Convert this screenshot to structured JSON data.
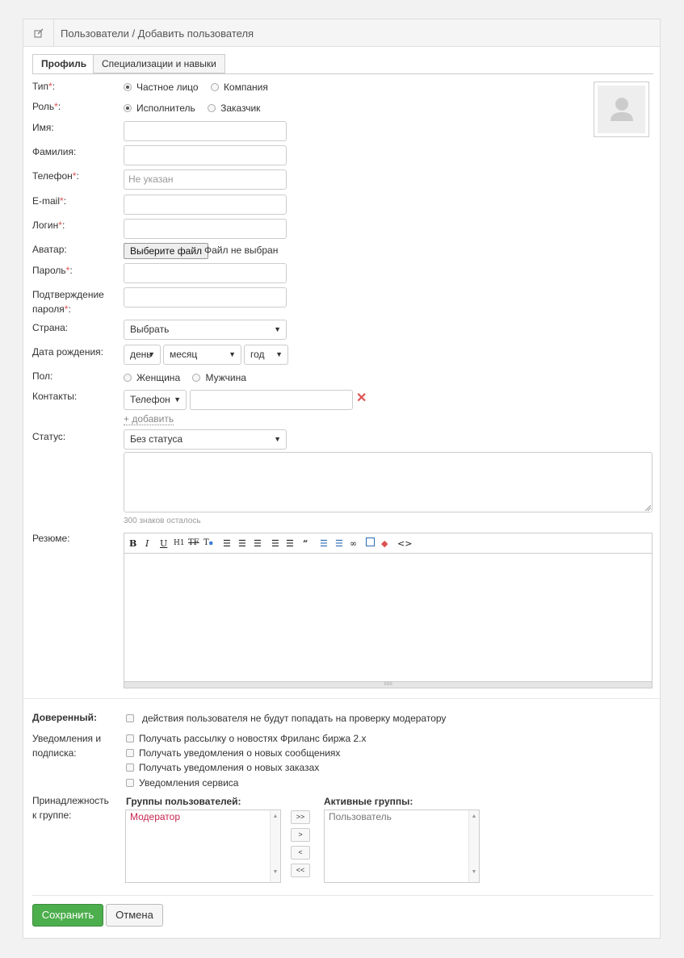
{
  "header": {
    "title": "Пользователи / Добавить пользователя",
    "icon": "edit-icon"
  },
  "tabs": [
    {
      "label": "Профиль",
      "active": true
    },
    {
      "label": "Специализации и навыки",
      "active": false
    }
  ],
  "form": {
    "type": {
      "label": "Тип",
      "options": [
        "Частное лицо",
        "Компания"
      ],
      "selected": "Частное лицо"
    },
    "role": {
      "label": "Роль",
      "options": [
        "Исполнитель",
        "Заказчик"
      ],
      "selected": "Исполнитель"
    },
    "first_name": {
      "label": "Имя:",
      "value": ""
    },
    "last_name": {
      "label": "Фамилия:",
      "value": ""
    },
    "phone": {
      "label": "Телефон",
      "placeholder": "Не указан"
    },
    "email": {
      "label": "E-mail"
    },
    "login": {
      "label": "Логин"
    },
    "avatar": {
      "label": "Аватар:",
      "button": "Выберите файл",
      "status": "Файл не выбран"
    },
    "password": {
      "label": "Пароль"
    },
    "password_confirm": {
      "label_line1": "Подтверждение",
      "label_line2": "пароля"
    },
    "country": {
      "label": "Страна:",
      "value": "Выбрать"
    },
    "birth_date": {
      "label": "Дата рождения:",
      "day": "день",
      "month": "месяц",
      "year": "год"
    },
    "gender": {
      "label": "Пол:",
      "options": [
        "Женщина",
        "Мужчина"
      ]
    },
    "contacts": {
      "label": "Контакты:",
      "type": "Телефон",
      "add_link": "+ добавить"
    },
    "status": {
      "label": "Статус:",
      "value": "Без статуса",
      "chars_left": "300 знаков осталось"
    },
    "resume": {
      "label": "Резюме:"
    }
  },
  "settings": {
    "trusted": {
      "label": "Доверенный:",
      "text": "действия пользователя не будут попадать на проверку модератору"
    },
    "notifications": {
      "label_line1": "Уведомления и",
      "label_line2": "подписка:",
      "items": [
        "Получать рассылку о новостях Фриланс биржа 2.x",
        "Получать уведомления о новых сообщениях",
        "Получать уведомления о новых заказах",
        "Уведомления сервиса"
      ]
    },
    "groups": {
      "label_line1": "Принадлежность",
      "label_line2": "к группе:",
      "available_title": "Группы пользователей:",
      "active_title": "Активные группы:",
      "available": [
        "Модератор"
      ],
      "active": [
        "Пользователь"
      ],
      "buttons": [
        ">>",
        ">",
        "<",
        "<<"
      ]
    }
  },
  "actions": {
    "save": "Сохранить",
    "cancel": "Отмена"
  },
  "colors": {
    "save_bg": "#4cae4c",
    "required": "#d9534f",
    "moderator": "#c7254e",
    "delete": "#e05555"
  }
}
